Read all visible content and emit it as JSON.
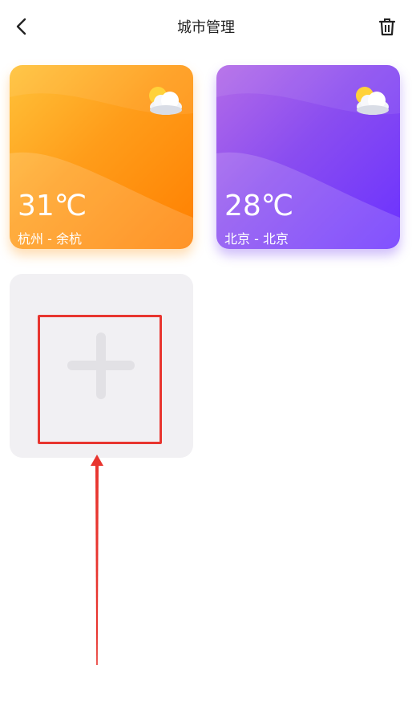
{
  "header": {
    "title": "城市管理",
    "back_icon": "back-chevron-icon",
    "delete_icon": "trash-icon"
  },
  "cities": [
    {
      "temperature": "31℃",
      "location": "杭州 - 余杭",
      "icon": "partly-cloudy-icon",
      "accent": "#ff9d1a"
    },
    {
      "temperature": "28℃",
      "location": "北京 - 北京",
      "icon": "partly-cloudy-icon",
      "accent": "#7b45f5"
    }
  ],
  "add_city": {
    "icon": "plus-icon"
  },
  "annotation": {
    "color": "#e8352f"
  }
}
